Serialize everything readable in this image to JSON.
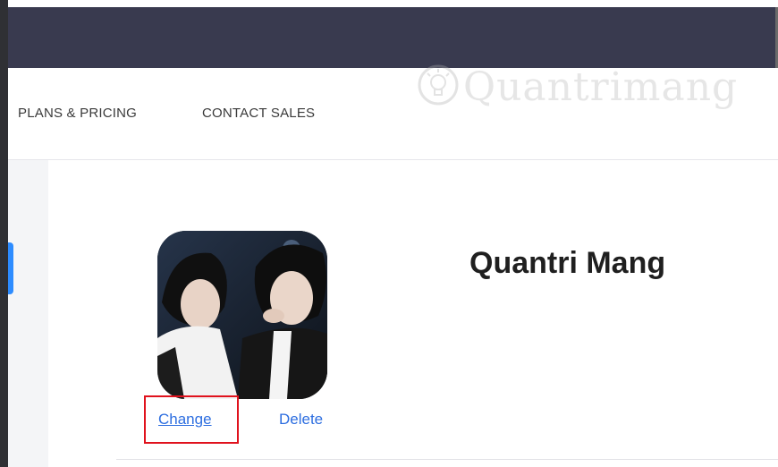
{
  "nav": {
    "plans_pricing": "PLANS & PRICING",
    "contact_sales": "CONTACT SALES"
  },
  "watermark": {
    "text": "Quantrimang",
    "icon": "bulb-icon"
  },
  "profile": {
    "name": "Quantri Mang",
    "change_label": "Change",
    "delete_label": "Delete"
  },
  "colors": {
    "topbar": "#393a4f",
    "link": "#2d6ee0",
    "accent": "#2d8cff",
    "highlight": "#e0121d"
  }
}
